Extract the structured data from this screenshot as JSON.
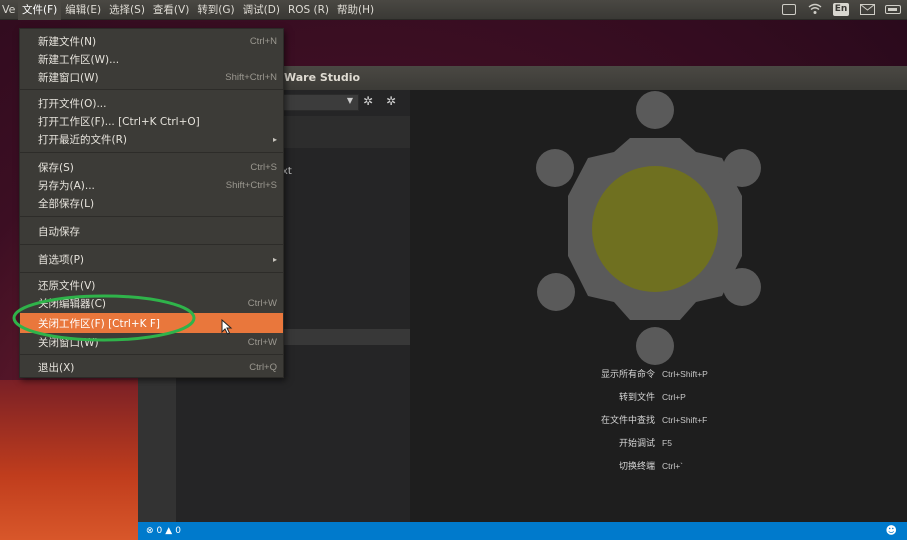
{
  "menubar": {
    "app_label": "Ve",
    "items": [
      {
        "label": "文件(F)",
        "active": true
      },
      {
        "label": "编辑(E)"
      },
      {
        "label": "选择(S)"
      },
      {
        "label": "查看(V)"
      },
      {
        "label": "转到(G)"
      },
      {
        "label": "调试(D)"
      },
      {
        "label": "ROS (R)"
      },
      {
        "label": "帮助(H)"
      }
    ],
    "tray": {
      "lang": "En"
    }
  },
  "window": {
    "title_fragment": "Ware Studio",
    "explorer_partial_text": "xt"
  },
  "file_menu": {
    "items": [
      {
        "label": "新建文件(N)",
        "shortcut": "Ctrl+N"
      },
      {
        "label": "新建工作区(W)...",
        "shortcut": ""
      },
      {
        "label": "新建窗口(W)",
        "shortcut": "Shift+Ctrl+N"
      },
      {
        "label": "打开文件(O)...",
        "shortcut": ""
      },
      {
        "label": "打开工作区(F)... [Ctrl+K Ctrl+O]",
        "shortcut": ""
      },
      {
        "label": "打开最近的文件(R)",
        "shortcut": "▸"
      },
      {
        "label": "保存(S)",
        "shortcut": "Ctrl+S"
      },
      {
        "label": "另存为(A)...",
        "shortcut": "Shift+Ctrl+S"
      },
      {
        "label": "全部保存(L)",
        "shortcut": ""
      },
      {
        "label": "自动保存",
        "shortcut": ""
      },
      {
        "label": "首选项(P)",
        "shortcut": "▸"
      },
      {
        "label": "还原文件(V)",
        "shortcut": ""
      },
      {
        "label": "关闭编辑器(C)",
        "shortcut": "Ctrl+W"
      },
      {
        "label": "关闭工作区(F) [Ctrl+K F]",
        "shortcut": ""
      },
      {
        "label": "关闭窗口(W)",
        "shortcut": "Ctrl+W"
      },
      {
        "label": "退出(X)",
        "shortcut": "Ctrl+Q"
      }
    ]
  },
  "shortcuts": [
    {
      "label": "显示所有命令",
      "key": "Ctrl+Shift+P"
    },
    {
      "label": "转到文件",
      "key": "Ctrl+P"
    },
    {
      "label": "在文件中查找",
      "key": "Ctrl+Shift+F"
    },
    {
      "label": "开始调试",
      "key": "F5"
    },
    {
      "label": "切换终端",
      "key": "Ctrl+`"
    }
  ],
  "status_bar": {
    "errors": "0",
    "warnings": "0",
    "color": "#007acc"
  },
  "colors": {
    "menu_highlight": "#e9773c",
    "annotation": "#2fb34a",
    "logo_gear": "#5a5a5a",
    "logo_core": "#6f7020"
  }
}
